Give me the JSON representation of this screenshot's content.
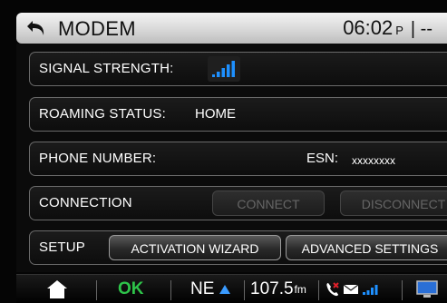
{
  "header": {
    "title": "MODEM",
    "clock": {
      "time": "06:02",
      "ampm": "P",
      "separator": "| --"
    }
  },
  "rows": {
    "signal": {
      "label": "SIGNAL STRENGTH:",
      "bars_filled": 4,
      "bars_total": 4
    },
    "roaming": {
      "label": "ROAMING STATUS:",
      "value": "HOME"
    },
    "phone": {
      "label": "PHONE NUMBER:",
      "esn_label": "ESN:",
      "esn_value": "xxxxxxxx"
    },
    "connection": {
      "label": "CONNECTION",
      "connect_label": "CONNECT",
      "disconnect_label": "DISCONNECT",
      "connect_enabled": false,
      "disconnect_enabled": false
    },
    "setup": {
      "label": "SETUP",
      "activation_label": "ACTIVATION WIZARD",
      "advanced_label": "ADVANCED SETTINGS"
    }
  },
  "statusbar": {
    "ok": "OK",
    "compass": "NE",
    "frequency": "107.5",
    "band": "fm"
  },
  "colors": {
    "ok_green": "#2ec44a",
    "signal_blue": "#1e90ff",
    "arrow_blue": "#3a9bff",
    "phone_red": "#e0202a"
  },
  "icons": {
    "back": "back-arrow-icon",
    "signal": "signal-bars-icon",
    "home": "home-icon",
    "compass_arrow": "triangle-up-icon",
    "phone": "phone-icon",
    "mail": "envelope-icon",
    "status_signal": "signal-bars-icon",
    "screen": "monitor-icon"
  }
}
